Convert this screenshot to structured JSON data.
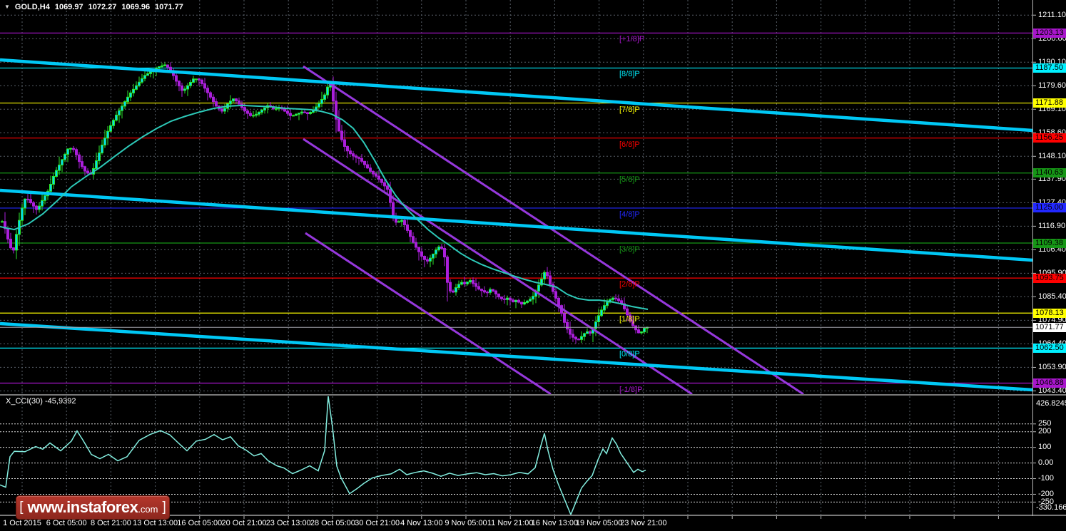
{
  "title": {
    "dropdown_icon": "▼",
    "symbol": "GOLD,H4",
    "open": "1069.97",
    "high": "1072.27",
    "low": "1069.96",
    "close": "1071.77"
  },
  "watermark": {
    "open_bracket": "[",
    "main": "www.instaforex",
    "suffix": ".com",
    "close_bracket": "]"
  },
  "colors": {
    "background": "#000000",
    "grid": "#585F68",
    "axis_text": "#FFFFFF",
    "axis_line": "#B8B8B8",
    "separator": "#787878",
    "thick_trend_cyan": "#00C8F5",
    "steep_channel_violet": "#9638DC",
    "ma_line": "#2DC9B8",
    "cci_line": "#84EFE1",
    "cci_level": "#DCDCDC",
    "candle_up_border": "#2BE52B",
    "candle_up_fill": "#00D9F5",
    "candle_down": "#AB1FDB",
    "current_price_line": "#A0A0A8",
    "current_price_box": "#FFFFFF"
  },
  "chart_data": [
    {
      "type": "candlestick",
      "title": "GOLD,H4",
      "current_bar": {
        "open": 1069.97,
        "high": 1072.27,
        "low": 1069.96,
        "close": 1071.77
      },
      "price_axis_ticks": [
        "1211.10",
        "1200.60",
        "1190.10",
        "1179.60",
        "1169.10",
        "1158.60",
        "1148.10",
        "1137.90",
        "1127.40",
        "1116.90",
        "1106.40",
        "1095.90",
        "1085.40",
        "1074.90",
        "1064.40",
        "1053.90",
        "1043.40"
      ],
      "murrey_levels": [
        {
          "label": "[+1/8]P",
          "price": 1203.13,
          "price_label": "1203.13",
          "color": "#A816CC"
        },
        {
          "label": "[8/8]P",
          "price": 1187.5,
          "price_label": "1187.50",
          "color": "#00F0FF"
        },
        {
          "label": "[7/8]P",
          "price": 1171.88,
          "price_label": "1171.88",
          "color": "#FFFF00"
        },
        {
          "label": "[6/8]P",
          "price": 1156.25,
          "price_label": "1156.25",
          "color": "#FF0000"
        },
        {
          "label": "[5/8]P",
          "price": 1140.63,
          "price_label": "1140.63",
          "color": "#169616"
        },
        {
          "label": "[4/8]P",
          "price": 1125.0,
          "price_label": "1125.00",
          "color": "#2228FF"
        },
        {
          "label": "[3/8]P",
          "price": 1109.38,
          "price_label": "1109.38",
          "color": "#169616"
        },
        {
          "label": "[2/8]P",
          "price": 1093.75,
          "price_label": "1093.75",
          "color": "#FF0000"
        },
        {
          "label": "[1/8]P",
          "price": 1078.13,
          "price_label": "1078.13",
          "color": "#FFFF00"
        },
        {
          "label": "[0/8]P",
          "price": 1062.5,
          "price_label": "1062.50",
          "color": "#00F0FF"
        },
        {
          "label": "[-1/8]P",
          "price": 1046.88,
          "price_label": "1046.88",
          "color": "#A816CC"
        }
      ],
      "current_price": {
        "value": 1071.77,
        "label": "1071.77"
      },
      "x_axis_labels": [
        "1 Oct 2015",
        "6 Oct 05:00",
        "8 Oct 21:00",
        "13 Oct 13:00",
        "16 Oct 05:00",
        "20 Oct 21:00",
        "23 Oct 13:00",
        "28 Oct 05:00",
        "30 Oct 21:00",
        "4 Nov 13:00",
        "9 Nov 05:00",
        "11 Nov 21:00",
        "16 Nov 13:00",
        "19 Nov 05:00",
        "23 Nov 21:00"
      ],
      "trend_lines": [
        {
          "name": "descending-line-upper",
          "x1": 0,
          "y1": 84,
          "x2": 1447,
          "y2": 183
        },
        {
          "name": "descending-line-middle",
          "x1": 0,
          "y1": 267,
          "x2": 1447,
          "y2": 365
        },
        {
          "name": "descending-line-lower",
          "x1": 0,
          "y1": 454,
          "x2": 1447,
          "y2": 547
        }
      ],
      "channel_lines": [
        {
          "name": "steep-channel-1",
          "x1": 425,
          "y1": 93,
          "x2": 1126,
          "y2": 553
        },
        {
          "name": "steep-channel-2",
          "x1": 425,
          "y1": 195,
          "x2": 970,
          "y2": 553
        },
        {
          "name": "steep-channel-3",
          "x1": 428,
          "y1": 327,
          "x2": 772,
          "y2": 553
        }
      ],
      "close_waypoints": [
        [
          0,
          1121
        ],
        [
          6,
          1117
        ],
        [
          12,
          1110
        ],
        [
          18,
          1104.5
        ],
        [
          24,
          1115
        ],
        [
          30,
          1124
        ],
        [
          36,
          1130
        ],
        [
          44,
          1127
        ],
        [
          52,
          1124
        ],
        [
          60,
          1129
        ],
        [
          68,
          1133
        ],
        [
          76,
          1140
        ],
        [
          86,
          1146
        ],
        [
          96,
          1152
        ],
        [
          104,
          1151
        ],
        [
          112,
          1145
        ],
        [
          120,
          1141
        ],
        [
          128,
          1140
        ],
        [
          136,
          1147
        ],
        [
          144,
          1154
        ],
        [
          152,
          1160
        ],
        [
          162,
          1166
        ],
        [
          172,
          1171
        ],
        [
          182,
          1176
        ],
        [
          192,
          1180
        ],
        [
          202,
          1184
        ],
        [
          212,
          1186
        ],
        [
          222,
          1188
        ],
        [
          232,
          1189
        ],
        [
          240,
          1186
        ],
        [
          248,
          1181
        ],
        [
          256,
          1177
        ],
        [
          264,
          1180
        ],
        [
          272,
          1183
        ],
        [
          280,
          1182
        ],
        [
          288,
          1178
        ],
        [
          296,
          1174
        ],
        [
          304,
          1170
        ],
        [
          312,
          1168
        ],
        [
          320,
          1172
        ],
        [
          328,
          1174
        ],
        [
          336,
          1171
        ],
        [
          344,
          1168
        ],
        [
          352,
          1166
        ],
        [
          360,
          1167
        ],
        [
          368,
          1169
        ],
        [
          376,
          1171
        ],
        [
          384,
          1169
        ],
        [
          392,
          1170
        ],
        [
          400,
          1168
        ],
        [
          408,
          1166
        ],
        [
          416,
          1167
        ],
        [
          424,
          1168
        ],
        [
          432,
          1167
        ],
        [
          440,
          1169
        ],
        [
          448,
          1172
        ],
        [
          456,
          1176
        ],
        [
          462,
          1182
        ],
        [
          466,
          1175
        ],
        [
          470,
          1166
        ],
        [
          476,
          1158
        ],
        [
          482,
          1153
        ],
        [
          488,
          1150
        ],
        [
          496,
          1148
        ],
        [
          504,
          1147
        ],
        [
          512,
          1144
        ],
        [
          520,
          1141
        ],
        [
          528,
          1139
        ],
        [
          536,
          1136
        ],
        [
          544,
          1133
        ],
        [
          550,
          1122
        ],
        [
          556,
          1118
        ],
        [
          562,
          1120
        ],
        [
          568,
          1117
        ],
        [
          574,
          1113
        ],
        [
          580,
          1109
        ],
        [
          586,
          1106
        ],
        [
          592,
          1103
        ],
        [
          598,
          1101
        ],
        [
          604,
          1103
        ],
        [
          610,
          1106
        ],
        [
          616,
          1108
        ],
        [
          622,
          1106
        ],
        [
          628,
          1089
        ],
        [
          634,
          1087
        ],
        [
          640,
          1090
        ],
        [
          646,
          1092
        ],
        [
          652,
          1091
        ],
        [
          658,
          1093
        ],
        [
          664,
          1091
        ],
        [
          670,
          1089
        ],
        [
          676,
          1088
        ],
        [
          682,
          1087
        ],
        [
          688,
          1089
        ],
        [
          694,
          1087
        ],
        [
          700,
          1085
        ],
        [
          706,
          1084
        ],
        [
          712,
          1085
        ],
        [
          718,
          1083
        ],
        [
          724,
          1084
        ],
        [
          730,
          1082
        ],
        [
          736,
          1083
        ],
        [
          742,
          1084
        ],
        [
          748,
          1086
        ],
        [
          754,
          1090
        ],
        [
          760,
          1094
        ],
        [
          764,
          1097
        ],
        [
          768,
          1094
        ],
        [
          772,
          1090
        ],
        [
          776,
          1087
        ],
        [
          780,
          1084
        ],
        [
          786,
          1079
        ],
        [
          792,
          1073
        ],
        [
          798,
          1069
        ],
        [
          804,
          1067
        ],
        [
          810,
          1066
        ],
        [
          816,
          1068
        ],
        [
          822,
          1070
        ],
        [
          828,
          1069
        ],
        [
          832,
          1072
        ],
        [
          836,
          1075
        ],
        [
          842,
          1079
        ],
        [
          848,
          1082
        ],
        [
          854,
          1084
        ],
        [
          860,
          1085
        ],
        [
          866,
          1084
        ],
        [
          872,
          1082
        ],
        [
          878,
          1078
        ],
        [
          884,
          1074
        ],
        [
          890,
          1071
        ],
        [
          896,
          1069
        ],
        [
          900,
          1070
        ],
        [
          904,
          1071.8
        ]
      ],
      "ma_points": [
        [
          0,
          1116.7
        ],
        [
          20,
          1115.4
        ],
        [
          40,
          1118.0
        ],
        [
          60,
          1122.4
        ],
        [
          80,
          1128.2
        ],
        [
          100,
          1134.5
        ],
        [
          120,
          1139.0
        ],
        [
          140,
          1143.1
        ],
        [
          160,
          1147.9
        ],
        [
          180,
          1152.6
        ],
        [
          200,
          1156.8
        ],
        [
          220,
          1160.6
        ],
        [
          240,
          1163.8
        ],
        [
          260,
          1166.0
        ],
        [
          280,
          1167.9
        ],
        [
          300,
          1169.5
        ],
        [
          320,
          1170.5
        ],
        [
          340,
          1170.8
        ],
        [
          360,
          1170.5
        ],
        [
          380,
          1170.2
        ],
        [
          400,
          1169.5
        ],
        [
          420,
          1169.2
        ],
        [
          435,
          1168.9
        ],
        [
          450,
          1168.2
        ],
        [
          465,
          1166.9
        ],
        [
          480,
          1164.4
        ],
        [
          495,
          1160.6
        ],
        [
          510,
          1154.2
        ],
        [
          525,
          1146.3
        ],
        [
          540,
          1137.7
        ],
        [
          555,
          1130.4
        ],
        [
          570,
          1124.6
        ],
        [
          585,
          1119.9
        ],
        [
          600,
          1115.4
        ],
        [
          615,
          1111.6
        ],
        [
          630,
          1108.4
        ],
        [
          645,
          1104.9
        ],
        [
          660,
          1102.1
        ],
        [
          675,
          1099.8
        ],
        [
          690,
          1097.9
        ],
        [
          705,
          1096.3
        ],
        [
          720,
          1094.7
        ],
        [
          735,
          1093.2
        ],
        [
          750,
          1091.9
        ],
        [
          765,
          1090.9
        ],
        [
          780,
          1089.7
        ],
        [
          795,
          1086.5
        ],
        [
          810,
          1084.6
        ],
        [
          825,
          1083.9
        ],
        [
          840,
          1083.9
        ],
        [
          855,
          1083.3
        ],
        [
          870,
          1082.3
        ],
        [
          885,
          1081.1
        ],
        [
          897,
          1080.4
        ],
        [
          908,
          1079.8
        ]
      ]
    },
    {
      "type": "line",
      "title": "X_CCI(30)",
      "label_text": "X_CCI(30) -45,9392",
      "current_value": -45.9392,
      "ylim": [
        -330.1663,
        426.8245
      ],
      "max_label": "426.8245",
      "min_label": "-330.1663",
      "levels": [
        {
          "value": 250,
          "text": "250"
        },
        {
          "value": 200,
          "text": "200"
        },
        {
          "value": 100,
          "text": "100"
        },
        {
          "value": 0,
          "text": "0.00"
        },
        {
          "value": -100,
          "text": "-100"
        },
        {
          "value": -200,
          "text": "-200"
        },
        {
          "value": -250,
          "text": "-250"
        }
      ],
      "points": [
        [
          0,
          -140
        ],
        [
          8,
          -155
        ],
        [
          14,
          40
        ],
        [
          20,
          75
        ],
        [
          35,
          72
        ],
        [
          50,
          105
        ],
        [
          60,
          88
        ],
        [
          70,
          128
        ],
        [
          85,
          78
        ],
        [
          100,
          140
        ],
        [
          108,
          205
        ],
        [
          116,
          148
        ],
        [
          128,
          55
        ],
        [
          140,
          28
        ],
        [
          152,
          55
        ],
        [
          165,
          14
        ],
        [
          178,
          40
        ],
        [
          195,
          145
        ],
        [
          210,
          182
        ],
        [
          225,
          207
        ],
        [
          238,
          180
        ],
        [
          250,
          128
        ],
        [
          262,
          78
        ],
        [
          275,
          140
        ],
        [
          288,
          152
        ],
        [
          300,
          182
        ],
        [
          312,
          148
        ],
        [
          323,
          168
        ],
        [
          334,
          110
        ],
        [
          345,
          82
        ],
        [
          356,
          45
        ],
        [
          366,
          60
        ],
        [
          376,
          14
        ],
        [
          388,
          -18
        ],
        [
          398,
          -32
        ],
        [
          410,
          -68
        ],
        [
          422,
          -45
        ],
        [
          434,
          -18
        ],
        [
          446,
          -50
        ],
        [
          455,
          80
        ],
        [
          460,
          427
        ],
        [
          466,
          230
        ],
        [
          472,
          -20
        ],
        [
          478,
          -95
        ],
        [
          490,
          -196
        ],
        [
          500,
          -165
        ],
        [
          510,
          -130
        ],
        [
          522,
          -95
        ],
        [
          535,
          -80
        ],
        [
          548,
          -70
        ],
        [
          560,
          -40
        ],
        [
          570,
          -75
        ],
        [
          582,
          -60
        ],
        [
          594,
          -50
        ],
        [
          606,
          -65
        ],
        [
          618,
          -85
        ],
        [
          630,
          -65
        ],
        [
          642,
          -80
        ],
        [
          655,
          -70
        ],
        [
          668,
          -62
        ],
        [
          680,
          -75
        ],
        [
          692,
          -68
        ],
        [
          704,
          -82
        ],
        [
          716,
          -75
        ],
        [
          728,
          -60
        ],
        [
          740,
          -70
        ],
        [
          750,
          -30
        ],
        [
          758,
          110
        ],
        [
          763,
          190
        ],
        [
          768,
          80
        ],
        [
          775,
          -40
        ],
        [
          782,
          -130
        ],
        [
          790,
          -220
        ],
        [
          800,
          -330
        ],
        [
          808,
          -240
        ],
        [
          815,
          -160
        ],
        [
          822,
          -120
        ],
        [
          830,
          -80
        ],
        [
          838,
          20
        ],
        [
          845,
          90
        ],
        [
          850,
          60
        ],
        [
          858,
          160
        ],
        [
          864,
          120
        ],
        [
          870,
          60
        ],
        [
          876,
          20
        ],
        [
          882,
          -20
        ],
        [
          888,
          -60
        ],
        [
          894,
          -40
        ],
        [
          900,
          -55
        ],
        [
          905,
          -46
        ]
      ]
    }
  ]
}
